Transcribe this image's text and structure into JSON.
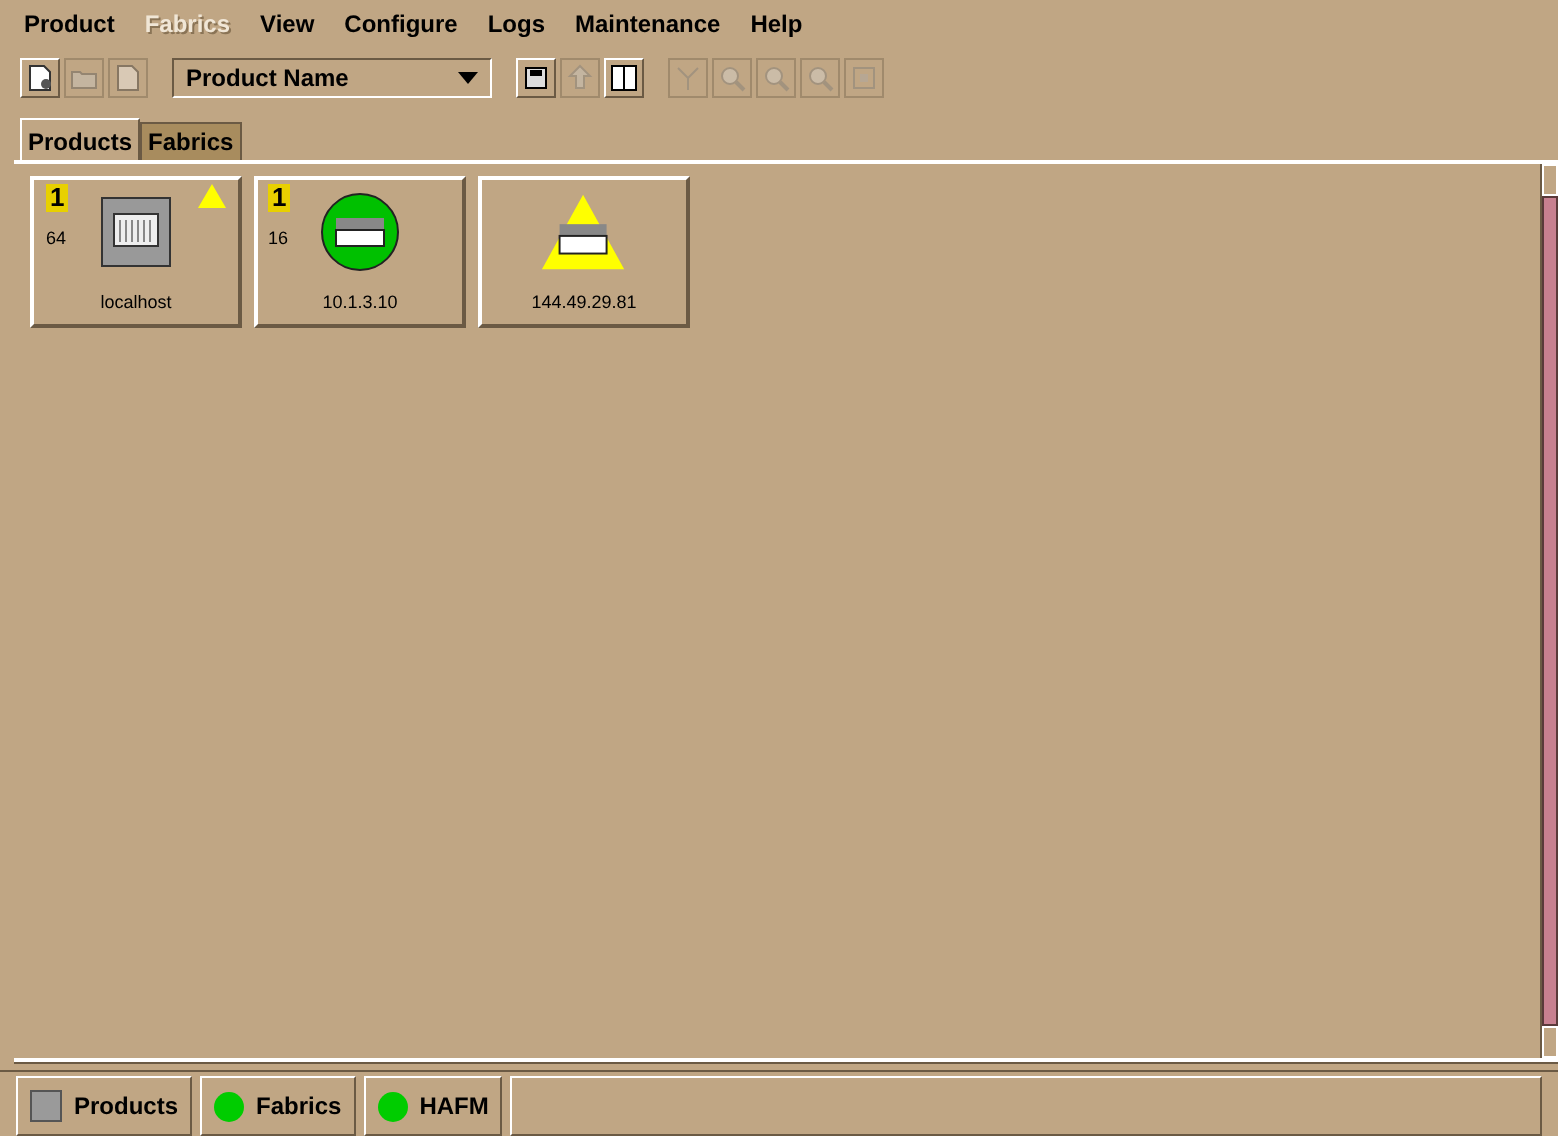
{
  "menu": [
    {
      "label": "Product",
      "disabled": false
    },
    {
      "label": "Fabrics",
      "disabled": true
    },
    {
      "label": "View",
      "disabled": false
    },
    {
      "label": "Configure",
      "disabled": false
    },
    {
      "label": "Logs",
      "disabled": false
    },
    {
      "label": "Maintenance",
      "disabled": false
    },
    {
      "label": "Help",
      "disabled": false
    }
  ],
  "toolbar_left": [
    {
      "kind": "new-doc",
      "disabled": false
    },
    {
      "kind": "folder",
      "disabled": true
    },
    {
      "kind": "doc",
      "disabled": true
    }
  ],
  "sort_dropdown": {
    "value": "Product Name"
  },
  "toolbar_mid": [
    {
      "kind": "save",
      "disabled": false
    },
    {
      "kind": "upload",
      "disabled": true
    },
    {
      "kind": "sort",
      "disabled": false
    }
  ],
  "toolbar_right": [
    {
      "kind": "tree",
      "disabled": true
    },
    {
      "kind": "zoom",
      "disabled": true
    },
    {
      "kind": "zoom-in",
      "disabled": true
    },
    {
      "kind": "zoom-out",
      "disabled": true
    },
    {
      "kind": "fit",
      "disabled": true
    }
  ],
  "tabs": [
    {
      "label": "Products",
      "selected": true
    },
    {
      "label": "Fabrics",
      "selected": false
    }
  ],
  "products": [
    {
      "name": "localhost",
      "kind": "switch",
      "badge": "1",
      "count": "64",
      "warning": true
    },
    {
      "name": "10.1.3.10",
      "kind": "ok",
      "badge": "1",
      "count": "16",
      "warning": false
    },
    {
      "name": "144.49.29.81",
      "kind": "alert",
      "warning": false
    }
  ],
  "status_tabs": [
    {
      "label": "Products",
      "kind": "square",
      "color": "#9a9a9a"
    },
    {
      "label": "Fabrics",
      "kind": "dot",
      "color": "#00cc00"
    },
    {
      "label": "HAFM",
      "kind": "dot",
      "color": "#00cc00"
    }
  ]
}
